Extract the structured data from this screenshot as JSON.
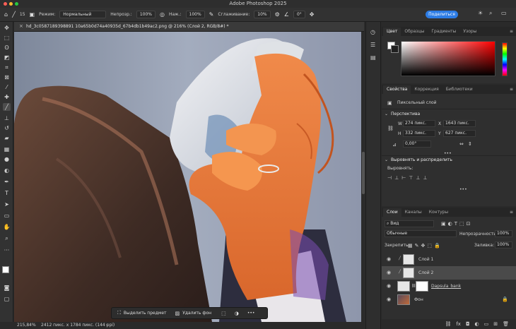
{
  "app": {
    "title": "Adobe Photoshop 2025"
  },
  "options_bar": {
    "mode_label": "Режим:",
    "mode_value": "Нормальный",
    "opacity_label": "Непрозр.:",
    "opacity_value": "100%",
    "pressure_label": "Наж.:",
    "pressure_value": "100%",
    "smoothing_label": "Сглаживание:",
    "smoothing_value": "10%",
    "brush_size": "15",
    "angle_value": "0°",
    "share_label": "Поделиться"
  },
  "document": {
    "tab_title": "hd_3c0587189398891 10a65b0d74a40935d_67b4db1b49ac2.png @ 216% (Слой 2, RGB/8#) *"
  },
  "status": {
    "zoom": "215,84%",
    "info": "2412 пикс. x 1784 пикс. (144 ppi)"
  },
  "context_bar": {
    "select_subject": "Выделить предмет",
    "remove_bg": "Удалить фон",
    "more": "•••"
  },
  "color_panel": {
    "tabs": [
      "Цвет",
      "Образцы",
      "Градиенты",
      "Узоры"
    ],
    "foreground": "#ffffff",
    "background": "#202020"
  },
  "properties_panel": {
    "tabs": [
      "Свойства",
      "Коррекция",
      "Библиотеки"
    ],
    "layer_type": "Пиксельный слой",
    "transform_title": "Перспектива",
    "w_label": "W",
    "w_value": "274 пикс.",
    "h_label": "H",
    "h_value": "332 пикс.",
    "x_label": "X",
    "x_value": "1643 пикс.",
    "y_label": "Y",
    "y_value": "627 пикс.",
    "angle_value": "0,00°",
    "align_title": "Выровнять и распределить",
    "align_label": "Выровнять:"
  },
  "layers_panel": {
    "tabs": [
      "Слои",
      "Каналы",
      "Контуры"
    ],
    "filter_label": "Вид",
    "blend_mode": "Обычные",
    "opacity_label": "Непрозрачность:",
    "opacity_value": "100%",
    "lock_label": "Закрепить:",
    "fill_label": "Заливка:",
    "fill_value": "100%",
    "layers": [
      {
        "name": "Слой 1",
        "selected": false
      },
      {
        "name": "Слой 2",
        "selected": true
      },
      {
        "name": "Dapsula_bank",
        "selected": false
      },
      {
        "name": "Фон",
        "selected": false
      }
    ],
    "bottom_icons": [
      "fx",
      "mask",
      "adjust",
      "folder",
      "new",
      "trash"
    ]
  }
}
